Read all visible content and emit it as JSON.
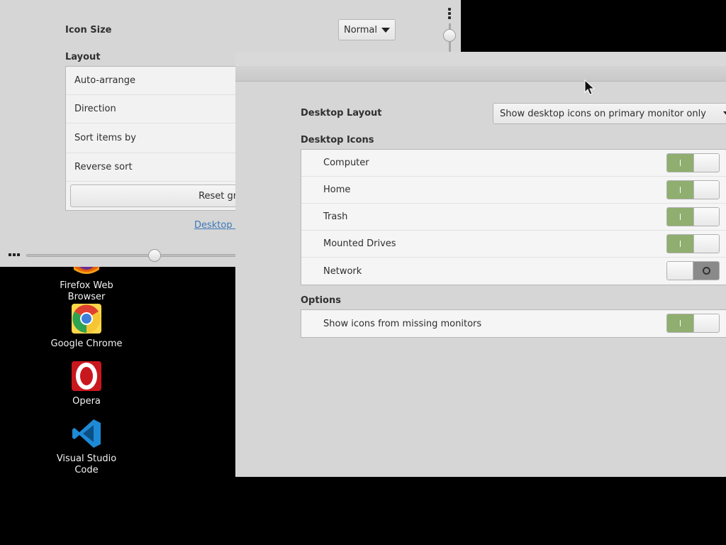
{
  "back_window": {
    "icon_size_label": "Icon Size",
    "icon_size_value": "Normal",
    "layout_label": "Layout",
    "layout_rows": [
      "Auto-arrange",
      "Direction",
      "Sort items by",
      "Reverse sort"
    ],
    "reset_grid_label": "Reset grid",
    "desktop_link": "Desktop S"
  },
  "desktop_icons": [
    {
      "label": "Firefox Web Browser"
    },
    {
      "label": "Google Chrome"
    },
    {
      "label": "Opera"
    },
    {
      "label": "Visual Studio Code"
    }
  ],
  "settings": {
    "desktop_layout_label": "Desktop Layout",
    "desktop_layout_value": "Show desktop icons on primary monitor only",
    "desktop_icons_header": "Desktop Icons",
    "desktop_icons": [
      {
        "label": "Computer",
        "on": true
      },
      {
        "label": "Home",
        "on": true
      },
      {
        "label": "Trash",
        "on": true
      },
      {
        "label": "Mounted Drives",
        "on": true
      },
      {
        "label": "Network",
        "on": false
      }
    ],
    "options_header": "Options",
    "options": [
      {
        "label": "Show icons from missing monitors",
        "on": true
      }
    ]
  },
  "colors": {
    "switch_on": "#8fae6f",
    "switch_off": "#8a8a8a",
    "link": "#3b78b8"
  }
}
